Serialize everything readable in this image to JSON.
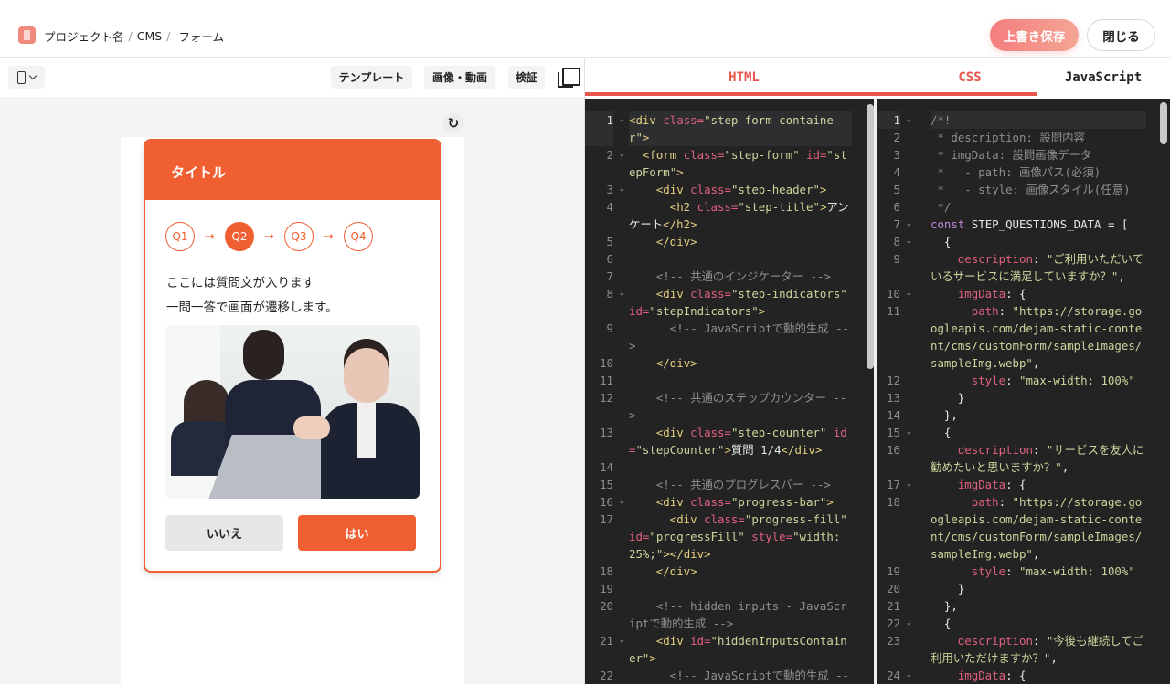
{
  "header": {
    "breadcrumb": [
      "プロジェクト名",
      "CMS",
      "フォーム"
    ],
    "breadcrumb_separator": "/",
    "save_label": "上書き保存",
    "close_label": "閉じる"
  },
  "toolbar": {
    "template_label": "テンプレート",
    "media_label": "画像・動画",
    "verify_label": "検証",
    "reload_glyph": "↻"
  },
  "preview": {
    "title": "タイトル",
    "steps": [
      "Q1",
      "Q2",
      "Q3",
      "Q4"
    ],
    "active_step": 1,
    "arrow": "→",
    "question_lines": [
      "ここには質問文が入ります",
      "一問一答で画面が遷移します。"
    ],
    "no_label": "いいえ",
    "yes_label": "はい"
  },
  "colors": {
    "accent": "#ef5f31",
    "save": "#f47e7e",
    "editor_bg": "#232323"
  },
  "tabs": [
    {
      "label": "HTML",
      "color": "#e8554f"
    },
    {
      "label": "CSS",
      "color": "#e8554f"
    },
    {
      "label": "JavaScript",
      "color": "#222222"
    }
  ],
  "html_code": [
    {
      "n": 1,
      "fold": true,
      "text": "<div class=\"step-form-container\">"
    },
    {
      "n": 2,
      "fold": true,
      "text": "  <form class=\"step-form\" id=\"stepForm\">"
    },
    {
      "n": 3,
      "fold": true,
      "text": "    <div class=\"step-header\">"
    },
    {
      "n": 4,
      "text": "      <h2 class=\"step-title\">アンケート</h2>"
    },
    {
      "n": 5,
      "text": "    </div>"
    },
    {
      "n": 6,
      "text": ""
    },
    {
      "n": 7,
      "text": "    <!-- 共通のインジケーター -->"
    },
    {
      "n": 8,
      "fold": true,
      "text": "    <div class=\"step-indicators\" id=\"stepIndicators\">"
    },
    {
      "n": 9,
      "text": "      <!-- JavaScriptで動的生成 -->"
    },
    {
      "n": 10,
      "text": "    </div>"
    },
    {
      "n": 11,
      "text": ""
    },
    {
      "n": 12,
      "text": "    <!-- 共通のステップカウンター -->"
    },
    {
      "n": 13,
      "text": "    <div class=\"step-counter\" id=\"stepCounter\">質問 1/4</div>"
    },
    {
      "n": 14,
      "text": ""
    },
    {
      "n": 15,
      "text": "    <!-- 共通のプログレスバー -->"
    },
    {
      "n": 16,
      "fold": true,
      "text": "    <div class=\"progress-bar\">"
    },
    {
      "n": 17,
      "text": "      <div class=\"progress-fill\" id=\"progressFill\" style=\"width: 25%;\"></div>"
    },
    {
      "n": 18,
      "text": "    </div>"
    },
    {
      "n": 19,
      "text": ""
    },
    {
      "n": 20,
      "text": "    <!-- hidden inputs - JavaScriptで動的生成 -->"
    },
    {
      "n": 21,
      "fold": true,
      "text": "    <div id=\"hiddenInputsContainer\">"
    },
    {
      "n": 22,
      "text": "      <!-- JavaScriptで動的生成 -->"
    }
  ],
  "js_code": [
    {
      "n": 1,
      "fold": true,
      "text": "/*!"
    },
    {
      "n": 2,
      "text": " * description: 設問内容"
    },
    {
      "n": 3,
      "text": " * imgData: 設問画像データ"
    },
    {
      "n": 4,
      "text": " *   - path: 画像パス(必須)"
    },
    {
      "n": 5,
      "text": " *   - style: 画像スタイル(任意)"
    },
    {
      "n": 6,
      "text": " */"
    },
    {
      "n": 7,
      "fold": true,
      "text": "const STEP_QUESTIONS_DATA = ["
    },
    {
      "n": 8,
      "fold": true,
      "text": "  {"
    },
    {
      "n": 9,
      "text": "    description: \"ご利用いただいているサービスに満足していますか？\","
    },
    {
      "n": 10,
      "fold": true,
      "text": "    imgData: {"
    },
    {
      "n": 11,
      "text": "      path: \"https://storage.googleapis.com/dejam-static-content/cms/customForm/sampleImages/sampleImg.webp\","
    },
    {
      "n": 12,
      "text": "      style: \"max-width: 100%\""
    },
    {
      "n": 13,
      "text": "    }"
    },
    {
      "n": 14,
      "text": "  },"
    },
    {
      "n": 15,
      "fold": true,
      "text": "  {"
    },
    {
      "n": 16,
      "text": "    description: \"サービスを友人に勧めたいと思いますか？\","
    },
    {
      "n": 17,
      "fold": true,
      "text": "    imgData: {"
    },
    {
      "n": 18,
      "text": "      path: \"https://storage.googleapis.com/dejam-static-content/cms/customForm/sampleImages/sampleImg.webp\","
    },
    {
      "n": 19,
      "text": "      style: \"max-width: 100%\""
    },
    {
      "n": 20,
      "text": "    }"
    },
    {
      "n": 21,
      "text": "  },"
    },
    {
      "n": 22,
      "fold": true,
      "text": "  {"
    },
    {
      "n": 23,
      "text": "    description: \"今後も継続してご利用いただけますか？\","
    },
    {
      "n": 24,
      "fold": true,
      "text": "    imgData: {"
    }
  ]
}
